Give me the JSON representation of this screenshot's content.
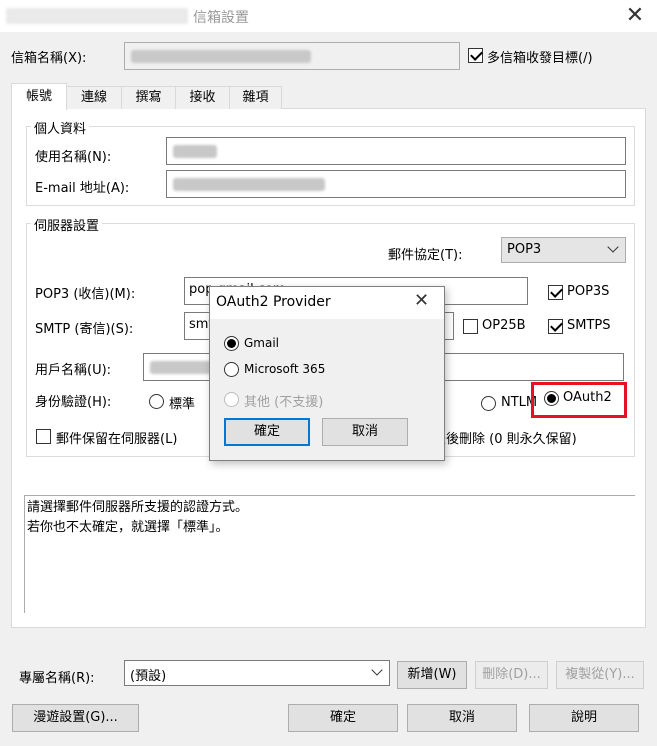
{
  "window": {
    "title": "信箱設置",
    "title_account": "[F] youshian@gmail.com",
    "close_glyph": "✕"
  },
  "mailbox": {
    "name_label": "信箱名稱(X):",
    "name_value": "[F] youshian@gmail.com",
    "multi_target_label": "多信箱收發目標(/)",
    "multi_target_checked": true
  },
  "tabs": [
    {
      "label": "帳號",
      "active": true
    },
    {
      "label": "連線",
      "active": false
    },
    {
      "label": "撰寫",
      "active": false
    },
    {
      "label": "接收",
      "active": false
    },
    {
      "label": "雜項",
      "active": false
    }
  ],
  "personal": {
    "group_title": "個人資料",
    "username_label": "使用名稱(N):",
    "username_value": "游宗鳳",
    "email_label": "E-mail 地址(A):",
    "email_value": "youshian@gmail.com"
  },
  "server": {
    "group_title": "伺服器設置",
    "protocol_label": "郵件協定(T):",
    "protocol_value": "POP3",
    "pop3_label": "POP3 (收信)(M):",
    "pop3_value": "pop.gmail.com",
    "pop3s_label": "POP3S",
    "pop3s_checked": true,
    "smtp_label": "SMTP (寄信)(S):",
    "smtp_value": "smtp.gmail.com",
    "op25b_label": "OP25B",
    "op25b_checked": false,
    "smtps_label": "SMTPS",
    "smtps_checked": true,
    "account_label": "用戶名稱(U):",
    "account_value": "youshian@gmail.com",
    "auth_label": "身份驗證(H):",
    "auth_standard": "標準",
    "auth_ntlm": "NTLM",
    "auth_oauth2": "OAuth2",
    "auth_selected": "OAuth2",
    "keep_mail_label": "郵件保留在伺服器(L)",
    "keep_mail_checked": false,
    "delete_after_text": "天後刪除 (0 則永久保留)"
  },
  "description": {
    "line1": "請選擇郵件伺服器所支援的認證方式。",
    "line2": "若你也不太確定，就選擇「標準」。"
  },
  "profile": {
    "label": "專屬名稱(R):",
    "value": "(預設)",
    "new_button": "新增(W)",
    "delete_button": "刪除(D)...",
    "copy_button": "複製從(Y)..."
  },
  "footer": {
    "roaming_button": "漫遊設置(G)...",
    "ok_button": "確定",
    "cancel_button": "取消",
    "help_button": "說明"
  },
  "oauth_dialog": {
    "title": "OAuth2 Provider",
    "close_glyph": "✕",
    "options": [
      {
        "label": "Gmail",
        "checked": true,
        "disabled": false
      },
      {
        "label": "Microsoft 365",
        "checked": false,
        "disabled": false
      },
      {
        "label": "其他 (不支援)",
        "checked": false,
        "disabled": true
      }
    ],
    "ok_button": "確定",
    "cancel_button": "取消"
  },
  "colors": {
    "highlight_border": "#e81123",
    "default_button_border": "#0078d7"
  }
}
